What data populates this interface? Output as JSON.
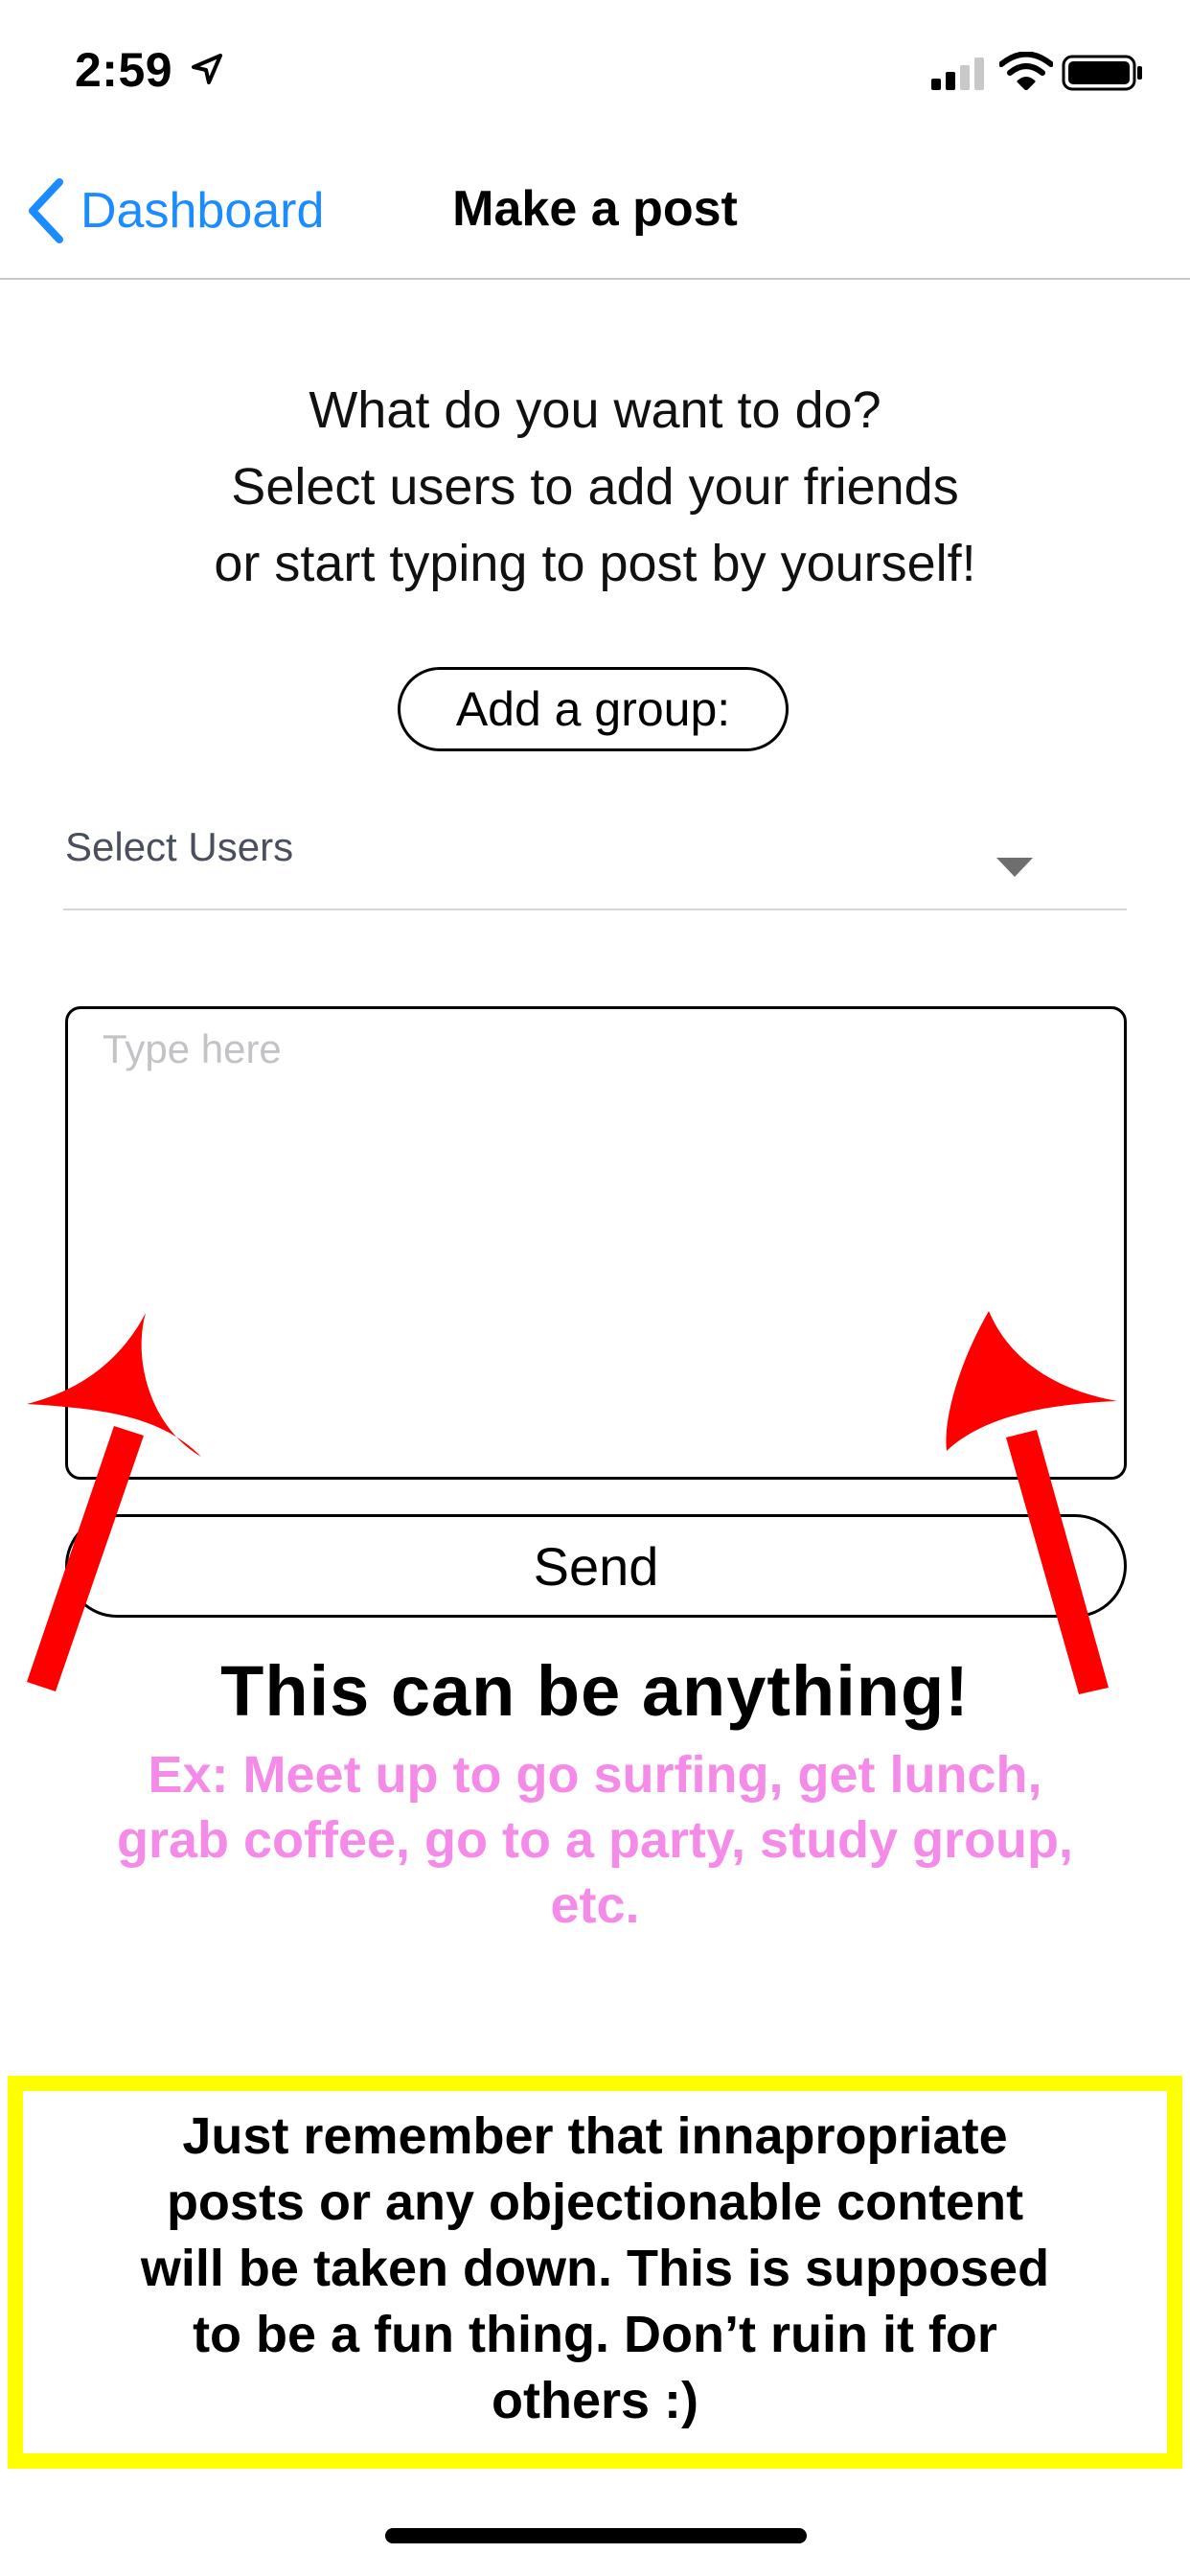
{
  "status_bar": {
    "time": "2:59",
    "icons": [
      "location-arrow-icon",
      "cellular-signal-icon",
      "wifi-icon",
      "battery-icon"
    ]
  },
  "nav": {
    "back_label": "Dashboard",
    "back_icon": "chevron-left-icon",
    "title": "Make a post",
    "accent_color": "#1a8cff"
  },
  "main": {
    "instructions": [
      "What do you want to do?",
      "Select users to add your friends",
      "or start typing to post by yourself!"
    ],
    "add_group_label": "Add a group:",
    "select_users": {
      "placeholder": "Select Users",
      "icon": "caret-down-icon"
    },
    "post_input": {
      "value": "",
      "placeholder": "Type here"
    },
    "send_label": "Send"
  },
  "annotations": {
    "arrows_color": "#ff0000",
    "headline": "This can be anything!",
    "example_lines": [
      "Ex: Meet up to go surfing, get lunch,",
      "grab coffee, go to a party, study group,",
      "etc."
    ],
    "example_color": "#f58be9",
    "warning_lines": [
      "Just remember that innapropriate",
      "posts or any objectionable content",
      "will be taken down. This is supposed",
      "to be a fun thing. Don’t ruin it for",
      "others :)"
    ],
    "warning_border_color": "#ffff00"
  }
}
